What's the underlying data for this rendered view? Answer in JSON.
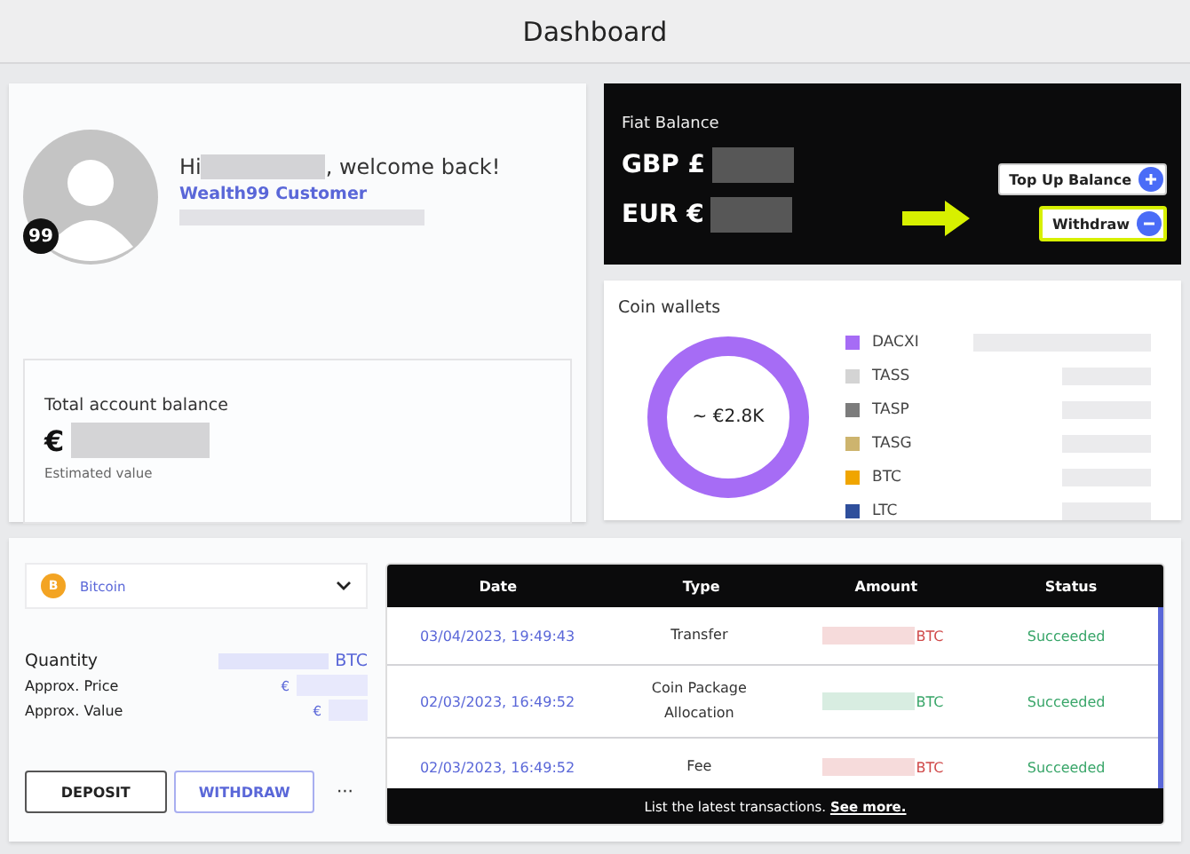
{
  "header": {
    "title": "Dashboard"
  },
  "profile": {
    "greeting_start": "Hi",
    "greeting_end": ", welcome back!",
    "tier": "Wealth99 Customer",
    "badge": "99"
  },
  "total_balance": {
    "label": "Total account balance",
    "currency": "€",
    "note": "Estimated value"
  },
  "fiat_balance": {
    "title": "Fiat Balance",
    "rows": [
      {
        "currency": "GBP £"
      },
      {
        "currency": "EUR €"
      }
    ],
    "buttons": [
      {
        "label": "Top Up Balance",
        "kind": "add",
        "highlighted": false
      },
      {
        "label": "Withdraw",
        "kind": "remove",
        "highlighted": true
      }
    ]
  },
  "coin_wallets": {
    "title": "Coin wallets",
    "total": "~ €2.8K",
    "coins": [
      {
        "name": "DACXI",
        "color": "#a66cf5"
      },
      {
        "name": "TASS",
        "color": "#d4d4d4"
      },
      {
        "name": "TASP",
        "color": "#7c7c7c"
      },
      {
        "name": "TASG",
        "color": "#cdb46e"
      },
      {
        "name": "BTC",
        "color": "#f0a500"
      },
      {
        "name": "LTC",
        "color": "#2f4f9c"
      }
    ]
  },
  "coin_panel": {
    "selector": {
      "icon": "B",
      "label": "Bitcoin"
    },
    "quantity_label": "Quantity",
    "quantity_unit": "BTC",
    "price_label": "Approx. Price",
    "price_currency": "€",
    "value_label": "Approx. Value",
    "value_currency": "€",
    "buttons": [
      "DEPOSIT",
      "WITHDRAW"
    ],
    "more": "···"
  },
  "transactions": {
    "columns": [
      "Date",
      "Type",
      "Amount",
      "Status"
    ],
    "rows": [
      {
        "date": "03/04/2023, 19:49:43",
        "type": "Transfer",
        "unit": "BTC",
        "color": "#d04a4a",
        "status": "Succeeded"
      },
      {
        "date": "02/03/2023, 16:49:52",
        "type": "Coin Package Allocation",
        "unit": "BTC",
        "color": "#3aa66a",
        "status": "Succeeded"
      },
      {
        "date": "02/03/2023, 16:49:52",
        "type": "Fee",
        "unit": "BTC",
        "color": "#d04a4a",
        "status": "Succeeded"
      }
    ],
    "footer_text": "List the latest transactions.",
    "footer_link": "See more."
  }
}
